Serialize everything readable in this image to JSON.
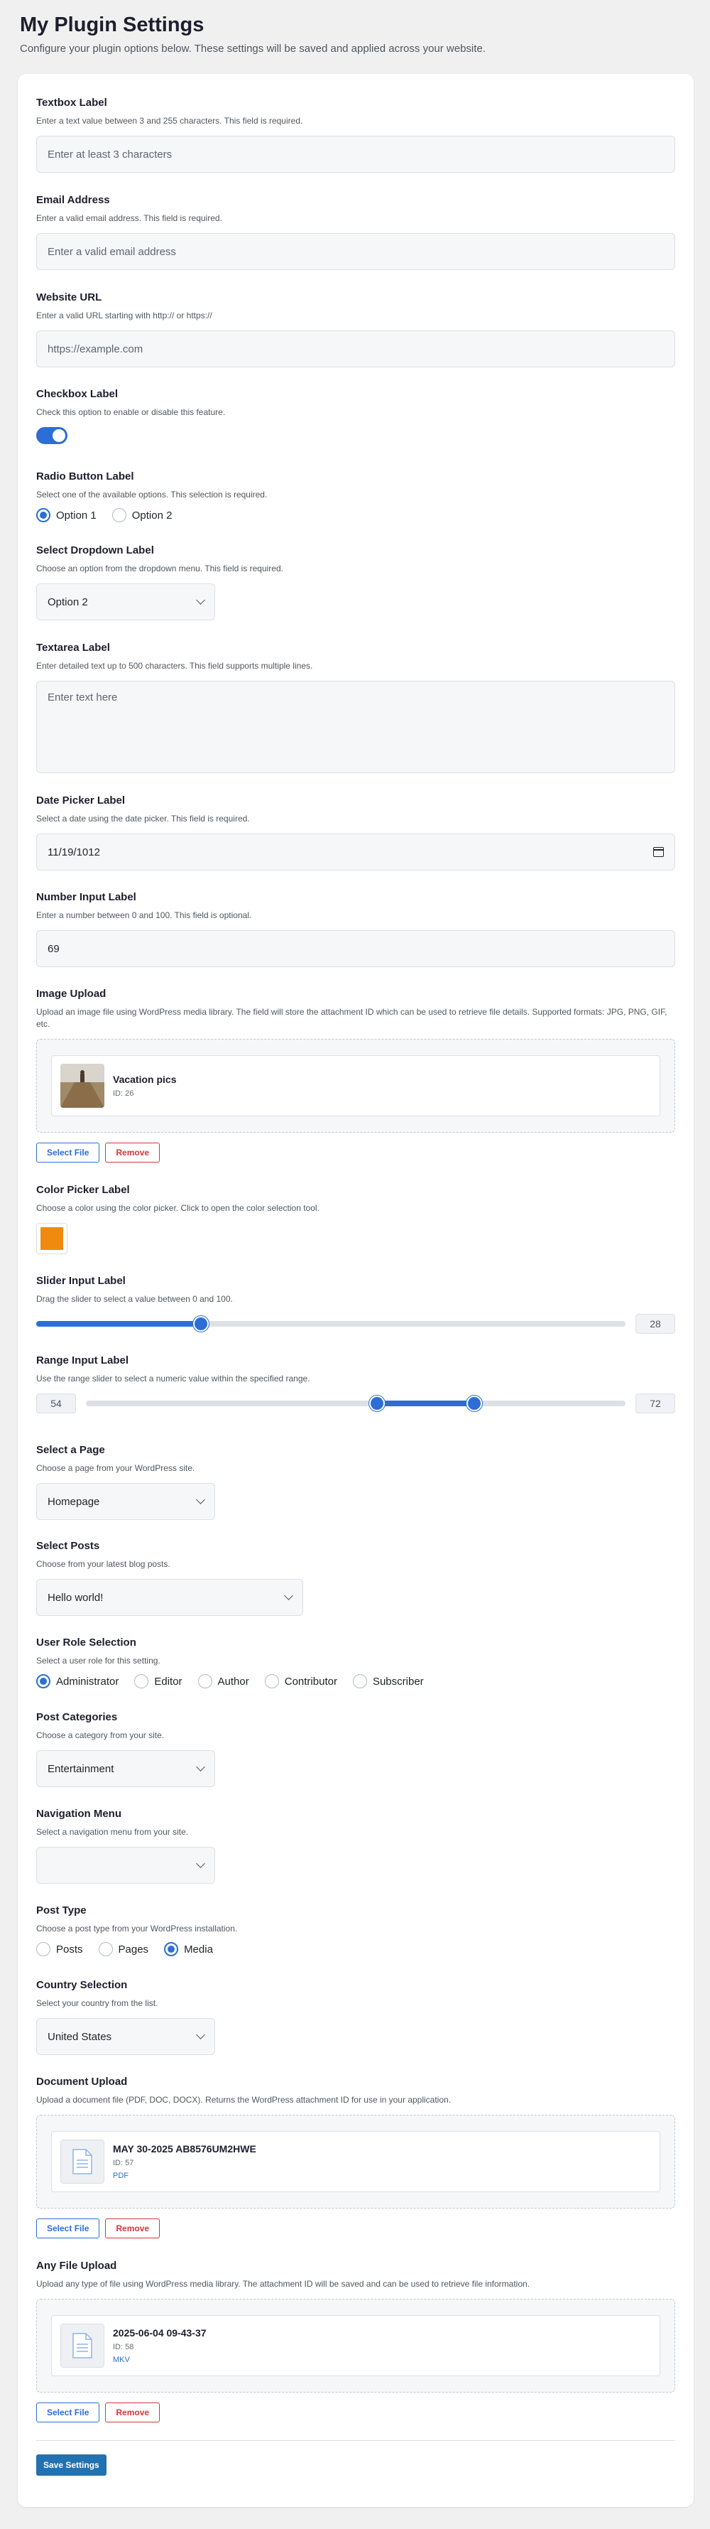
{
  "header": {
    "title": "My Plugin Settings",
    "description": "Configure your plugin options below. These settings will be saved and applied across your website."
  },
  "fields": {
    "textbox": {
      "label": "Textbox Label",
      "desc": "Enter a text value between 3 and 255 characters. This field is required.",
      "placeholder": "Enter at least 3 characters"
    },
    "email": {
      "label": "Email Address",
      "desc": "Enter a valid email address. This field is required.",
      "placeholder": "Enter a valid email address"
    },
    "url": {
      "label": "Website URL",
      "desc": "Enter a valid URL starting with http:// or https://",
      "placeholder": "https://example.com"
    },
    "checkbox": {
      "label": "Checkbox Label",
      "desc": "Check this option to enable or disable this feature.",
      "checked": true
    },
    "radio": {
      "label": "Radio Button Label",
      "desc": "Select one of the available options. This selection is required.",
      "options": [
        "Option 1",
        "Option 2"
      ],
      "selected": "Option 1"
    },
    "dropdown": {
      "label": "Select Dropdown Label",
      "desc": "Choose an option from the dropdown menu. This field is required.",
      "value": "Option 2"
    },
    "textarea": {
      "label": "Textarea Label",
      "desc": "Enter detailed text up to 500 characters. This field supports multiple lines.",
      "placeholder": "Enter text here"
    },
    "date": {
      "label": "Date Picker Label",
      "desc": "Select a date using the date picker. This field is required.",
      "value": "11/19/1012"
    },
    "number": {
      "label": "Number Input Label",
      "desc": "Enter a number between 0 and 100. This field is optional.",
      "value": "69"
    },
    "image": {
      "label": "Image Upload",
      "desc": "Upload an image file using WordPress media library. The field will store the attachment ID which can be used to retrieve file details. Supported formats: JPG, PNG, GIF, etc.",
      "file_name": "Vacation pics",
      "file_id": "ID: 26",
      "select_label": "Select File",
      "remove_label": "Remove"
    },
    "color": {
      "label": "Color Picker Label",
      "desc": "Choose a color using the color picker. Click to open the color selection tool.",
      "value": "#ef8a0f"
    },
    "slider": {
      "label": "Slider Input Label",
      "desc": "Drag the slider to select a value between 0 and 100.",
      "value": 28,
      "value_text": "28",
      "min": 0,
      "max": 100
    },
    "range": {
      "label": "Range Input Label",
      "desc": "Use the range slider to select a numeric value within the specified range.",
      "low": 54,
      "high": 72,
      "low_text": "54",
      "high_text": "72",
      "min": 0,
      "max": 100
    },
    "page": {
      "label": "Select a Page",
      "desc": "Choose a page from your WordPress site.",
      "value": "Homepage"
    },
    "posts": {
      "label": "Select Posts",
      "desc": "Choose from your latest blog posts.",
      "value": "Hello world!"
    },
    "role": {
      "label": "User Role Selection",
      "desc": "Select a user role for this setting.",
      "options": [
        "Administrator",
        "Editor",
        "Author",
        "Contributor",
        "Subscriber"
      ],
      "selected": "Administrator"
    },
    "category": {
      "label": "Post Categories",
      "desc": "Choose a category from your site.",
      "value": "Entertainment"
    },
    "menu": {
      "label": "Navigation Menu",
      "desc": "Select a navigation menu from your site.",
      "value": ""
    },
    "post_type": {
      "label": "Post Type",
      "desc": "Choose a post type from your WordPress installation.",
      "options": [
        "Posts",
        "Pages",
        "Media"
      ],
      "selected": "Media"
    },
    "country": {
      "label": "Country Selection",
      "desc": "Select your country from the list.",
      "value": "United States"
    },
    "document": {
      "label": "Document Upload",
      "desc": "Upload a document file (PDF, DOC, DOCX). Returns the WordPress attachment ID for use in your application.",
      "file_name": "MAY 30-2025 AB8576UM2HWE",
      "file_id": "ID: 57",
      "file_ext": "PDF",
      "select_label": "Select File",
      "remove_label": "Remove"
    },
    "anyfile": {
      "label": "Any File Upload",
      "desc": "Upload any type of file using WordPress media library. The attachment ID will be saved and can be used to retrieve file information.",
      "file_name": "2025-06-04 09-43-37",
      "file_id": "ID: 58",
      "file_ext": "MKV",
      "select_label": "Select File",
      "remove_label": "Remove"
    }
  },
  "footer": {
    "save_label": "Save Settings"
  },
  "colors": {
    "accent": "#2c6ed5",
    "danger": "#d63638",
    "save": "#2271b1"
  }
}
